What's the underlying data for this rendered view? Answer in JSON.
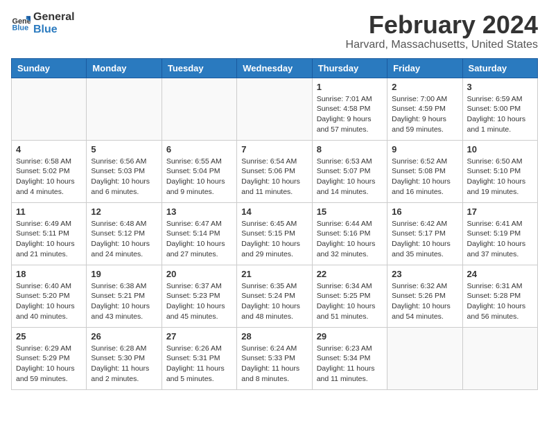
{
  "header": {
    "logo_general": "General",
    "logo_blue": "Blue",
    "month_title": "February 2024",
    "location": "Harvard, Massachusetts, United States"
  },
  "days_of_week": [
    "Sunday",
    "Monday",
    "Tuesday",
    "Wednesday",
    "Thursday",
    "Friday",
    "Saturday"
  ],
  "weeks": [
    [
      {
        "day": "",
        "info": ""
      },
      {
        "day": "",
        "info": ""
      },
      {
        "day": "",
        "info": ""
      },
      {
        "day": "",
        "info": ""
      },
      {
        "day": "1",
        "info": "Sunrise: 7:01 AM\nSunset: 4:58 PM\nDaylight: 9 hours and 57 minutes."
      },
      {
        "day": "2",
        "info": "Sunrise: 7:00 AM\nSunset: 4:59 PM\nDaylight: 9 hours and 59 minutes."
      },
      {
        "day": "3",
        "info": "Sunrise: 6:59 AM\nSunset: 5:00 PM\nDaylight: 10 hours and 1 minute."
      }
    ],
    [
      {
        "day": "4",
        "info": "Sunrise: 6:58 AM\nSunset: 5:02 PM\nDaylight: 10 hours and 4 minutes."
      },
      {
        "day": "5",
        "info": "Sunrise: 6:56 AM\nSunset: 5:03 PM\nDaylight: 10 hours and 6 minutes."
      },
      {
        "day": "6",
        "info": "Sunrise: 6:55 AM\nSunset: 5:04 PM\nDaylight: 10 hours and 9 minutes."
      },
      {
        "day": "7",
        "info": "Sunrise: 6:54 AM\nSunset: 5:06 PM\nDaylight: 10 hours and 11 minutes."
      },
      {
        "day": "8",
        "info": "Sunrise: 6:53 AM\nSunset: 5:07 PM\nDaylight: 10 hours and 14 minutes."
      },
      {
        "day": "9",
        "info": "Sunrise: 6:52 AM\nSunset: 5:08 PM\nDaylight: 10 hours and 16 minutes."
      },
      {
        "day": "10",
        "info": "Sunrise: 6:50 AM\nSunset: 5:10 PM\nDaylight: 10 hours and 19 minutes."
      }
    ],
    [
      {
        "day": "11",
        "info": "Sunrise: 6:49 AM\nSunset: 5:11 PM\nDaylight: 10 hours and 21 minutes."
      },
      {
        "day": "12",
        "info": "Sunrise: 6:48 AM\nSunset: 5:12 PM\nDaylight: 10 hours and 24 minutes."
      },
      {
        "day": "13",
        "info": "Sunrise: 6:47 AM\nSunset: 5:14 PM\nDaylight: 10 hours and 27 minutes."
      },
      {
        "day": "14",
        "info": "Sunrise: 6:45 AM\nSunset: 5:15 PM\nDaylight: 10 hours and 29 minutes."
      },
      {
        "day": "15",
        "info": "Sunrise: 6:44 AM\nSunset: 5:16 PM\nDaylight: 10 hours and 32 minutes."
      },
      {
        "day": "16",
        "info": "Sunrise: 6:42 AM\nSunset: 5:17 PM\nDaylight: 10 hours and 35 minutes."
      },
      {
        "day": "17",
        "info": "Sunrise: 6:41 AM\nSunset: 5:19 PM\nDaylight: 10 hours and 37 minutes."
      }
    ],
    [
      {
        "day": "18",
        "info": "Sunrise: 6:40 AM\nSunset: 5:20 PM\nDaylight: 10 hours and 40 minutes."
      },
      {
        "day": "19",
        "info": "Sunrise: 6:38 AM\nSunset: 5:21 PM\nDaylight: 10 hours and 43 minutes."
      },
      {
        "day": "20",
        "info": "Sunrise: 6:37 AM\nSunset: 5:23 PM\nDaylight: 10 hours and 45 minutes."
      },
      {
        "day": "21",
        "info": "Sunrise: 6:35 AM\nSunset: 5:24 PM\nDaylight: 10 hours and 48 minutes."
      },
      {
        "day": "22",
        "info": "Sunrise: 6:34 AM\nSunset: 5:25 PM\nDaylight: 10 hours and 51 minutes."
      },
      {
        "day": "23",
        "info": "Sunrise: 6:32 AM\nSunset: 5:26 PM\nDaylight: 10 hours and 54 minutes."
      },
      {
        "day": "24",
        "info": "Sunrise: 6:31 AM\nSunset: 5:28 PM\nDaylight: 10 hours and 56 minutes."
      }
    ],
    [
      {
        "day": "25",
        "info": "Sunrise: 6:29 AM\nSunset: 5:29 PM\nDaylight: 10 hours and 59 minutes."
      },
      {
        "day": "26",
        "info": "Sunrise: 6:28 AM\nSunset: 5:30 PM\nDaylight: 11 hours and 2 minutes."
      },
      {
        "day": "27",
        "info": "Sunrise: 6:26 AM\nSunset: 5:31 PM\nDaylight: 11 hours and 5 minutes."
      },
      {
        "day": "28",
        "info": "Sunrise: 6:24 AM\nSunset: 5:33 PM\nDaylight: 11 hours and 8 minutes."
      },
      {
        "day": "29",
        "info": "Sunrise: 6:23 AM\nSunset: 5:34 PM\nDaylight: 11 hours and 11 minutes."
      },
      {
        "day": "",
        "info": ""
      },
      {
        "day": "",
        "info": ""
      }
    ]
  ]
}
